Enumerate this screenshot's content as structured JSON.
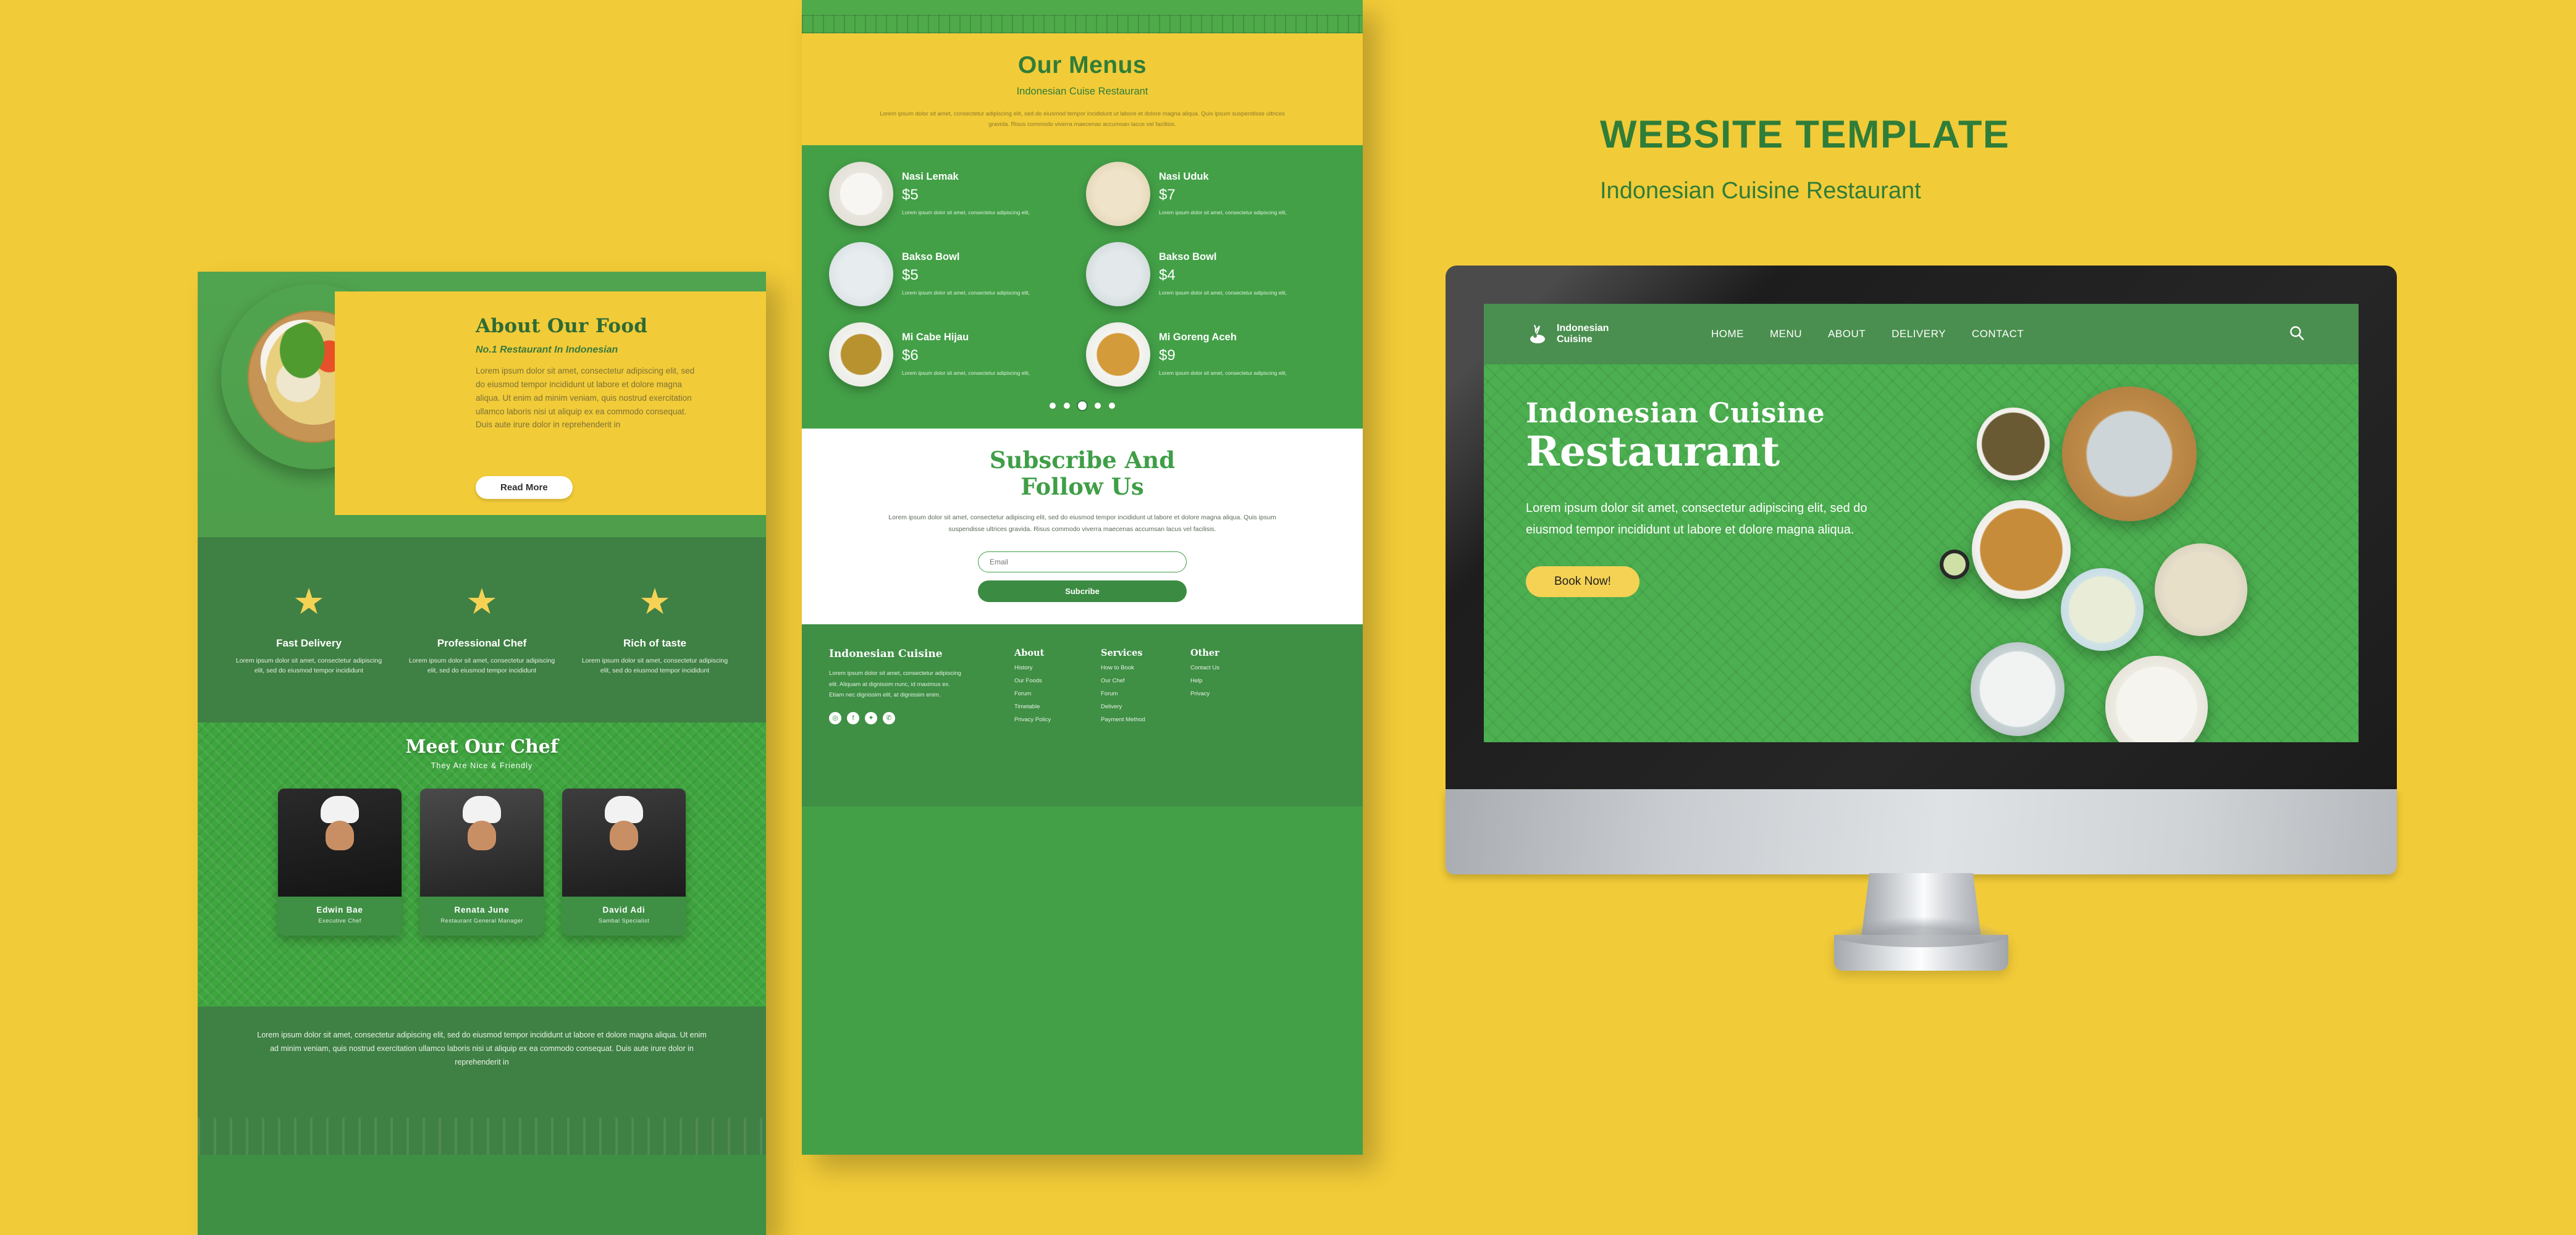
{
  "poster": {
    "title": "WEBSITE TEMPLATE",
    "subtitle": "Indonesian Cuisine Restaurant",
    "colors": {
      "background_yellow": "#f2cb38",
      "brand_green_dark": "#2f7d39",
      "brand_green": "#43a047",
      "accent_yellow": "#f5d254",
      "white": "#ffffff"
    }
  },
  "left_panel": {
    "about": {
      "title": "About Our Food",
      "subtitle": "No.1  Restaurant In Indonesian",
      "body": "Lorem ipsum dolor sit amet, consectetur adipiscing elit, sed do eiusmod tempor incididunt ut labore et dolore magna aliqua. Ut enim ad minim veniam, quis nostrud exercitation ullamco laboris nisi ut aliquip ex ea commodo consequat. Duis aute irure dolor in reprehenderit in",
      "button": "Read More",
      "image_name": "soto-ayam-bowl-photo"
    },
    "features": [
      {
        "icon": "star-icon",
        "title": "Fast Delivery",
        "desc": "Lorem ipsum dolor sit amet, consectetur adipiscing elit, sed do eiusmod tempor incididunt"
      },
      {
        "icon": "star-icon",
        "title": "Professional Chef",
        "desc": "Lorem ipsum dolor sit amet, consectetur adipiscing elit, sed do eiusmod tempor incididunt"
      },
      {
        "icon": "star-icon",
        "title": "Rich of taste",
        "desc": "Lorem ipsum dolor sit amet, consectetur adipiscing elit, sed do eiusmod tempor incididunt"
      }
    ],
    "chef": {
      "title": "Meet Our Chef",
      "subtitle": "They Are Nice & Friendly",
      "members": [
        {
          "name": "Edwin Bae",
          "role": "Executive Chef"
        },
        {
          "name": "Renata June",
          "role": "Restaurant General Manager"
        },
        {
          "name": "David Adi",
          "role": "Sambal Specialist"
        }
      ]
    },
    "bottom_text": "Lorem ipsum dolor sit amet, consectetur adipiscing elit, sed do eiusmod tempor incididunt ut labore et dolore magna aliqua. Ut enim ad minim veniam, quis nostrud exercitation ullamco laboris nisi ut aliquip ex ea commodo consequat. Duis aute irure dolor in reprehenderit in"
  },
  "mid_panel": {
    "menus": {
      "title": "Our Menus",
      "subtitle": "Indonesian Cuise Restaurant",
      "desc": "Lorem ipsum dolor sit amet, consectetur adipiscing elit, sed do eiusmod tempor incididunt ut labore et dolore magna aliqua. Quis ipsum suspendisse ultrices gravida. Risus commodo viverra maecenas accumsan lacus vel facilisis.",
      "items": [
        {
          "name": "Nasi Lemak",
          "price": "$5",
          "desc": "Lorem ipsum dolor sit amet, consectetur adipiscing elit,"
        },
        {
          "name": "Nasi Uduk",
          "price": "$7",
          "desc": "Lorem ipsum dolor sit amet, consectetur adipiscing elit,"
        },
        {
          "name": "Bakso Bowl",
          "price": "$5",
          "desc": "Lorem ipsum dolor sit amet, consectetur adipiscing elit,"
        },
        {
          "name": "Bakso Bowl",
          "price": "$4",
          "desc": "Lorem ipsum dolor sit amet, consectetur adipiscing elit,"
        },
        {
          "name": "Mi Cabe Hijau",
          "price": "$6",
          "desc": "Lorem ipsum dolor sit amet, consectetur adipiscing elit,"
        },
        {
          "name": "Mi Goreng Aceh",
          "price": "$9",
          "desc": "Lorem ipsum dolor sit amet, consectetur adipiscing elit,"
        }
      ],
      "carousel": {
        "total_dots": 5,
        "active_index": 2
      }
    },
    "subscribe": {
      "title_line1": "Subscribe And",
      "title_line2": "Follow Us",
      "desc": "Lorem ipsum dolor sit amet, consectetur adipiscing elit, sed do eiusmod tempor incididunt ut labore et dolore magna aliqua. Quis ipsum suspendisse ultrices gravida. Risus commodo viverra maecenas accumsan lacus vel facilisis.",
      "email_placeholder": "Email",
      "email_value": "",
      "button": "Subcribe"
    },
    "footer": {
      "brand": "Indonesian Cuisine",
      "brand_desc": "Lorem ipsum dolor sit amet, consectetur adipiscing elit. Aliquam at dignissim nunc, id maximus ex. Etiam nec dignissim elit, at dignissim enim.",
      "socials": [
        {
          "name": "instagram-icon",
          "glyph": "◎"
        },
        {
          "name": "facebook-icon",
          "glyph": "f"
        },
        {
          "name": "twitter-icon",
          "glyph": "✦"
        },
        {
          "name": "whatsapp-icon",
          "glyph": "✆"
        }
      ],
      "columns": [
        {
          "title": "About",
          "links": [
            "History",
            "Our Foods",
            "Forum",
            "Timetable",
            "Privacy Policy"
          ]
        },
        {
          "title": "Services",
          "links": [
            "How to Book",
            "Our Chef",
            "Forum",
            "Delivery",
            "Payment Method"
          ]
        },
        {
          "title": "Other",
          "links": [
            "Contact Us",
            "Help",
            "Privacy"
          ]
        }
      ]
    }
  },
  "monitor": {
    "nav": {
      "logo_line1": "Indonesian",
      "logo_line2": "Cuisine",
      "links": [
        "HOME",
        "MENU",
        "ABOUT",
        "DELIVERY",
        "CONTACT"
      ],
      "search_icon": "search-icon"
    },
    "hero": {
      "title_line1": "Indonesian Cuisine",
      "title_line2": "Restaurant",
      "paragraph": "Lorem ipsum dolor sit amet, consectetur adipiscing elit, sed do eiusmod tempor incididunt ut labore et dolore magna aliqua.",
      "cta": "Book Now!"
    }
  }
}
